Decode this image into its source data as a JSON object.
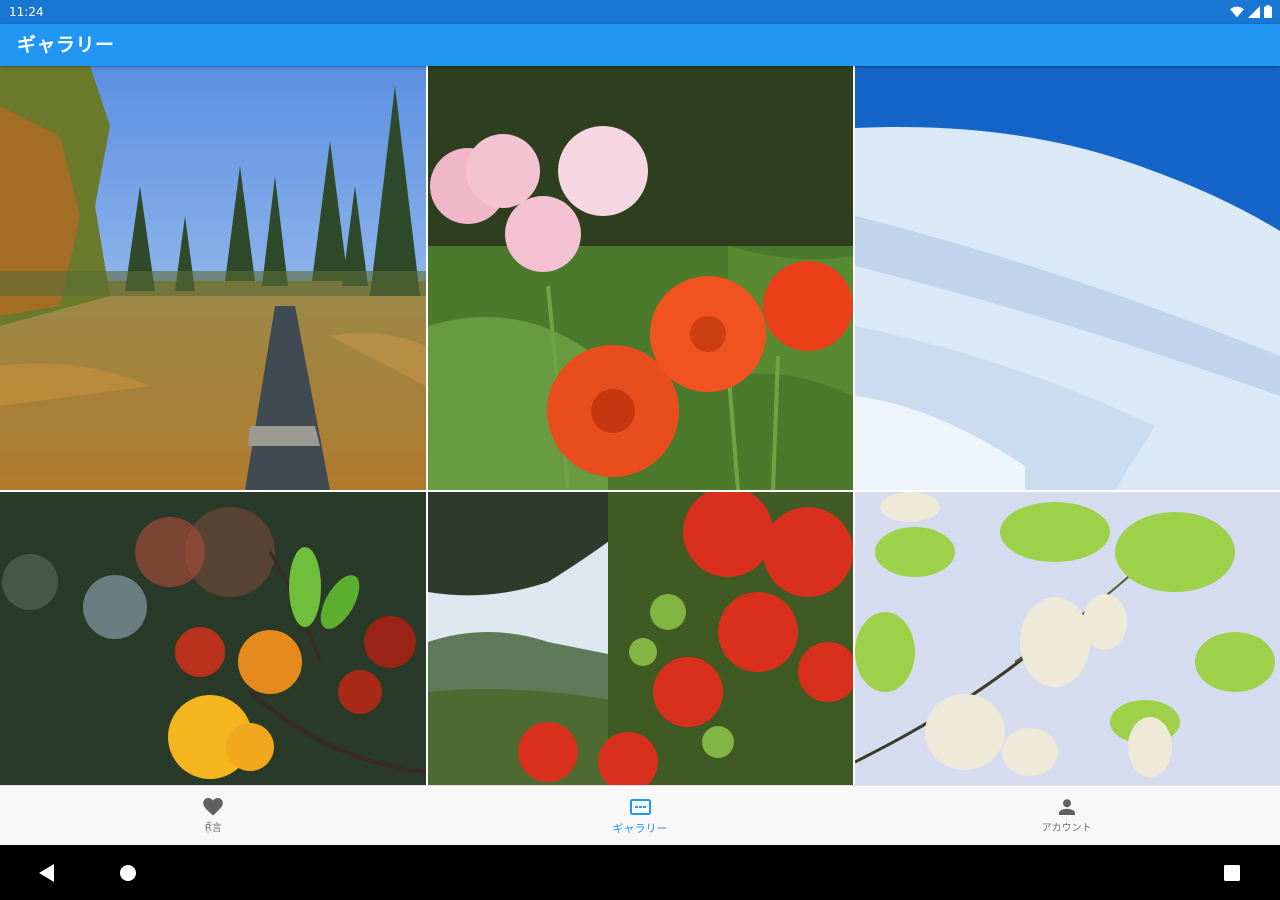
{
  "status_bar": {
    "time": "11:24",
    "icons": [
      "wifi-icon",
      "signal-icon",
      "battery-icon"
    ]
  },
  "app_bar": {
    "title": "ギャラリー"
  },
  "gallery": {
    "images": [
      {
        "subject": "autumn-marsh-boardwalk"
      },
      {
        "subject": "pink-and-red-ranunculus"
      },
      {
        "subject": "snow-covered-slope"
      },
      {
        "subject": "azalea-blossoms-closeup"
      },
      {
        "subject": "red-azaleas-mountain-view"
      },
      {
        "subject": "white-acacia-blossoms"
      }
    ]
  },
  "bottom_nav": {
    "items": [
      {
        "label": "Ṝ̈́言",
        "icon": "heart-icon",
        "active": false
      },
      {
        "label": "ギャラリー",
        "icon": "gallery-icon",
        "active": true
      },
      {
        "label": "アカウント",
        "icon": "person-icon",
        "active": false
      }
    ]
  },
  "colors": {
    "status_bar": "#1976d2",
    "app_bar": "#2196f3",
    "nav_active": "#2196f3",
    "nav_inactive": "#757575",
    "nav_background": "#f8f8f8"
  },
  "system_nav": {
    "buttons": [
      "back-icon",
      "home-icon",
      "recents-icon"
    ]
  }
}
